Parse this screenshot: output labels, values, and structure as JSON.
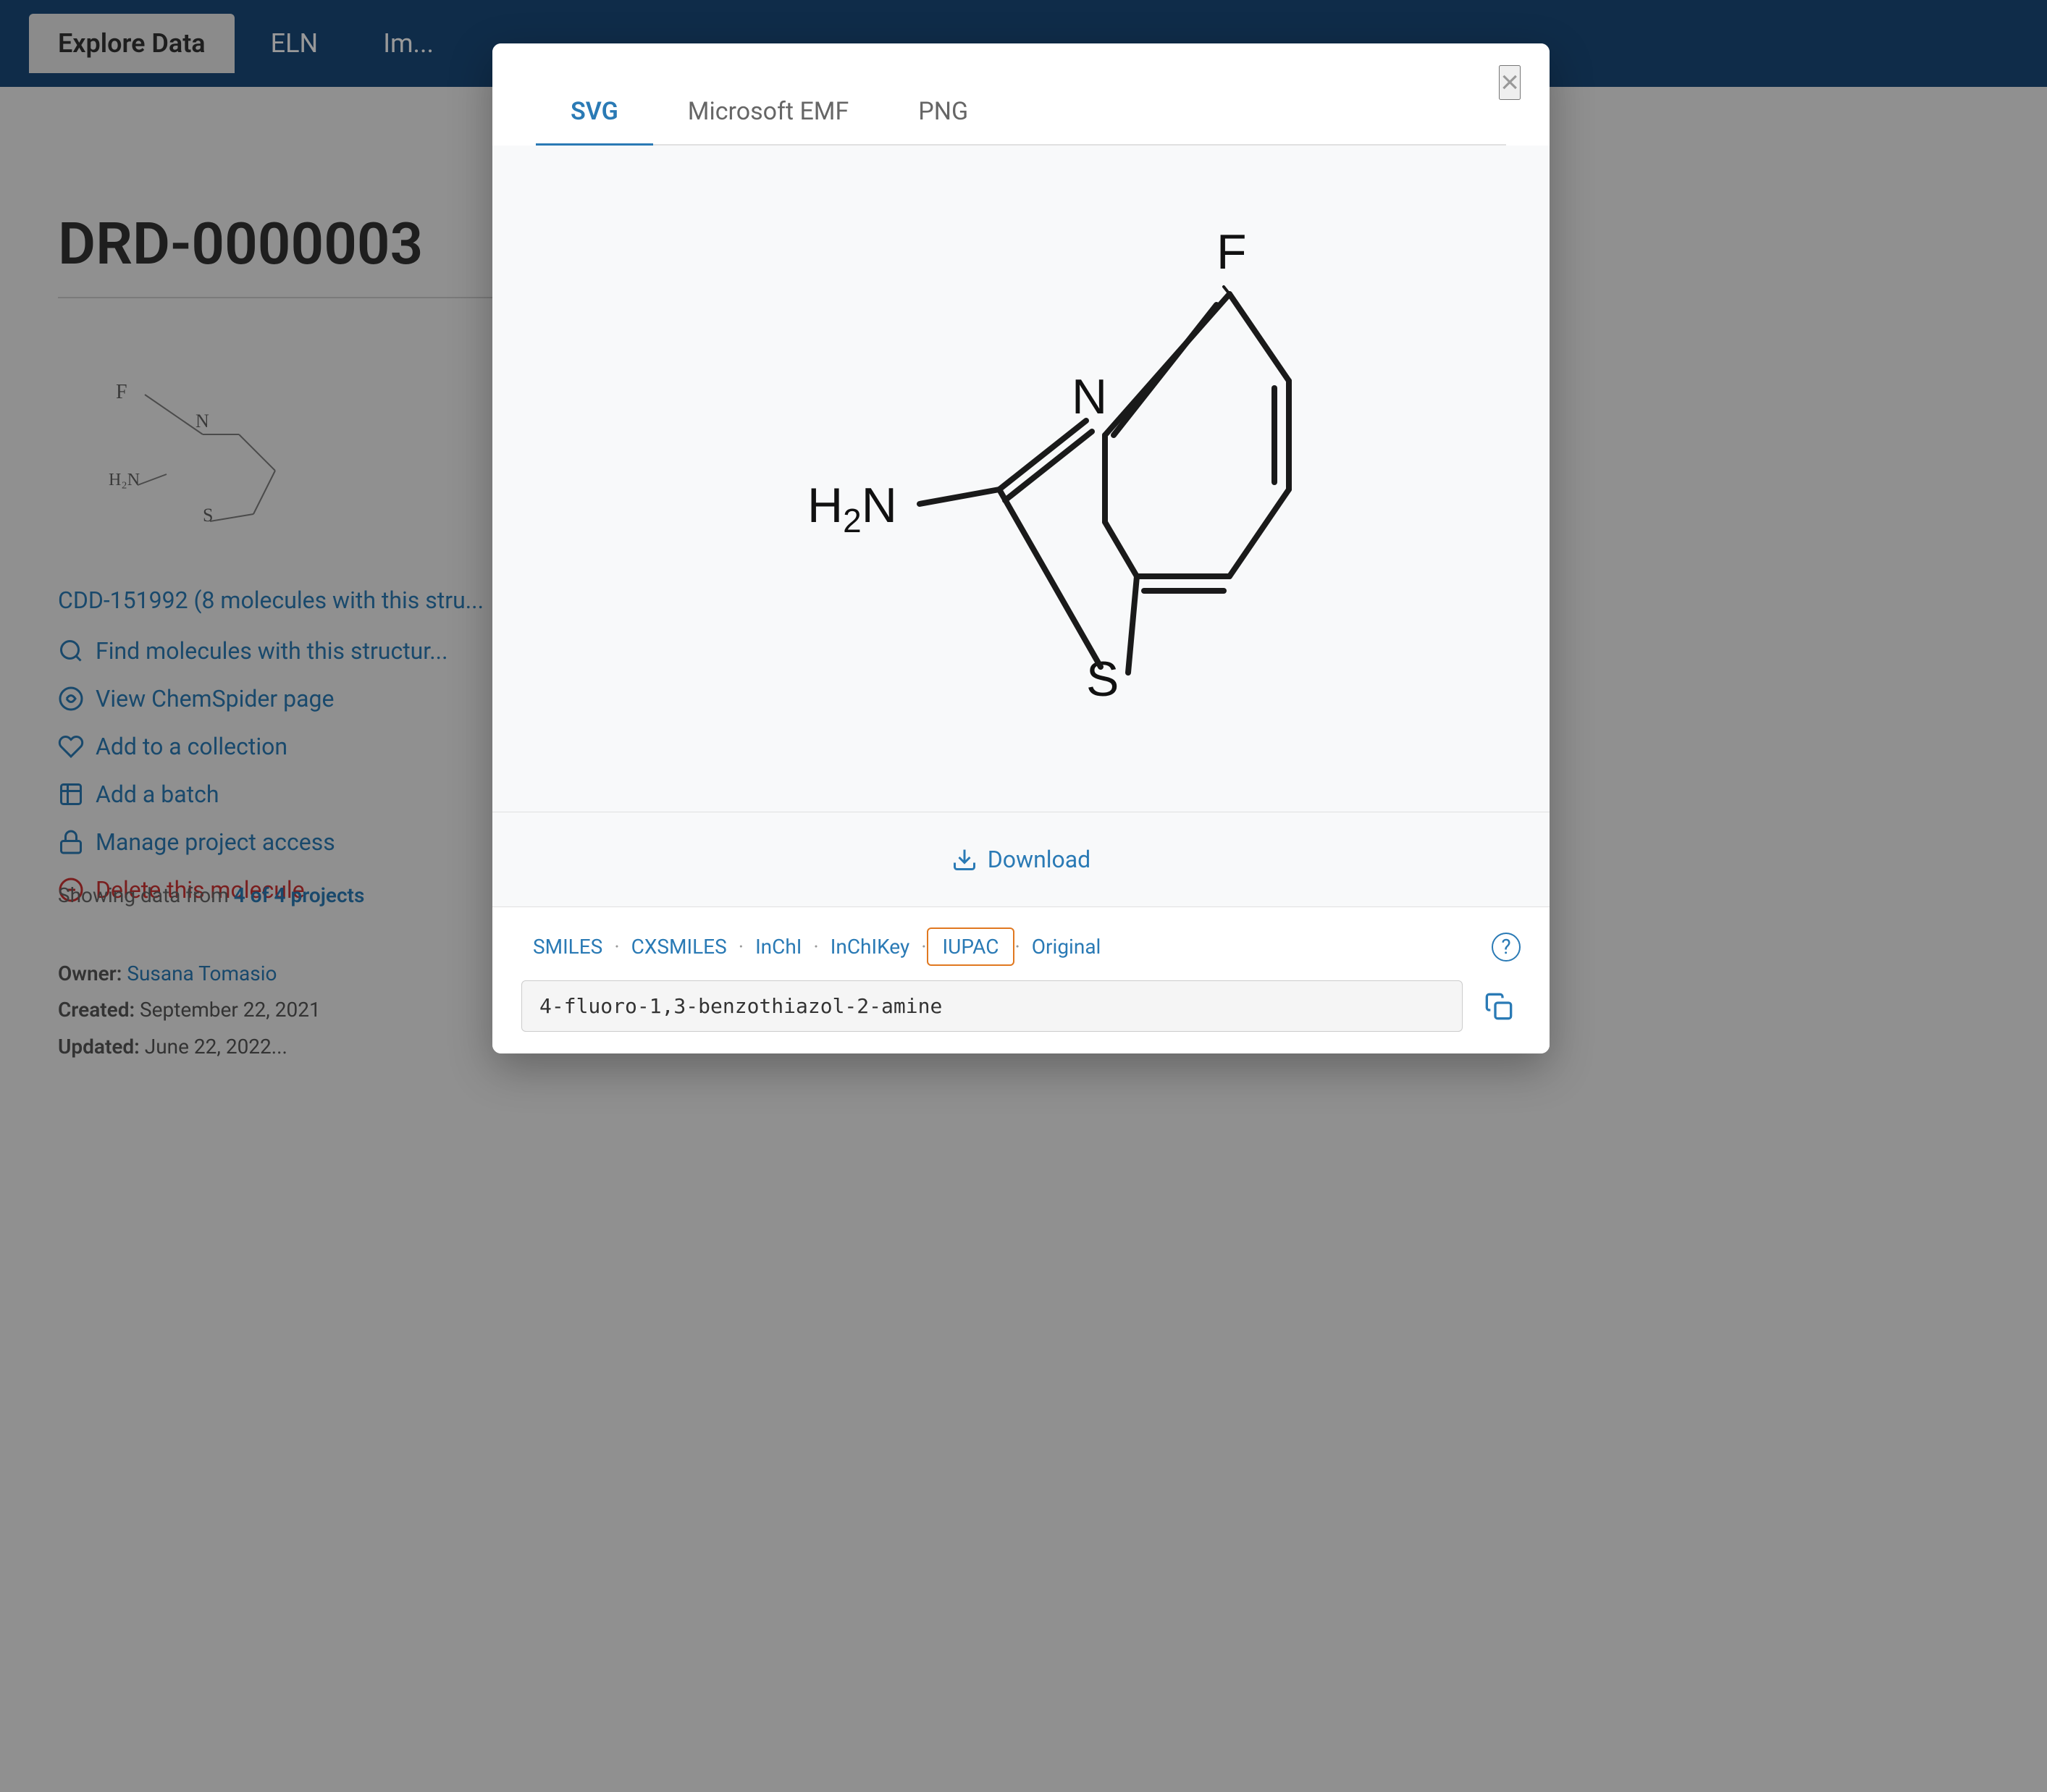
{
  "nav": {
    "tabs": [
      {
        "label": "Explore Data",
        "active": true
      },
      {
        "label": "ELN",
        "active": false
      },
      {
        "label": "Im...",
        "active": false
      }
    ]
  },
  "background": {
    "molecule_id": "DRD-0000003",
    "cdd_link": "CDD-151992",
    "cdd_link_suffix": " (8 molecules with this stru...",
    "links": [
      {
        "icon": "search",
        "label": "Find molecules with this structur..."
      },
      {
        "icon": "chemspider",
        "label": "View ChemSpider page"
      },
      {
        "icon": "collection",
        "label": "Add to a collection"
      },
      {
        "icon": "batch",
        "label": "Add a batch"
      },
      {
        "icon": "lock",
        "label": "Manage project access"
      },
      {
        "icon": "delete",
        "label": "Delete this molecule",
        "danger": true
      }
    ],
    "showing_data": "Showing data from 4 of 4 projects",
    "owner_label": "Owner:",
    "owner_value": "Susana Tomasio",
    "created_label": "Created:",
    "created_value": "September 22, 2021",
    "updated_label": "Updated:",
    "updated_value": "June 22, 2022..."
  },
  "modal": {
    "close_icon": "×",
    "tabs": [
      {
        "label": "SVG",
        "active": true
      },
      {
        "label": "Microsoft EMF",
        "active": false
      },
      {
        "label": "PNG",
        "active": false
      }
    ],
    "download_label": "Download",
    "chem_tabs": [
      {
        "label": "SMILES",
        "active": false
      },
      {
        "label": "CXSMILES",
        "active": false
      },
      {
        "label": "InChI",
        "active": false
      },
      {
        "label": "InChIKey",
        "active": false
      },
      {
        "label": "IUPAC",
        "active": true,
        "highlighted": true
      },
      {
        "label": "Original",
        "active": false
      }
    ],
    "chem_value": "4-fluoro-1,3-benzothiazol-2-amine",
    "help_label": "?",
    "copy_icon": "copy"
  }
}
